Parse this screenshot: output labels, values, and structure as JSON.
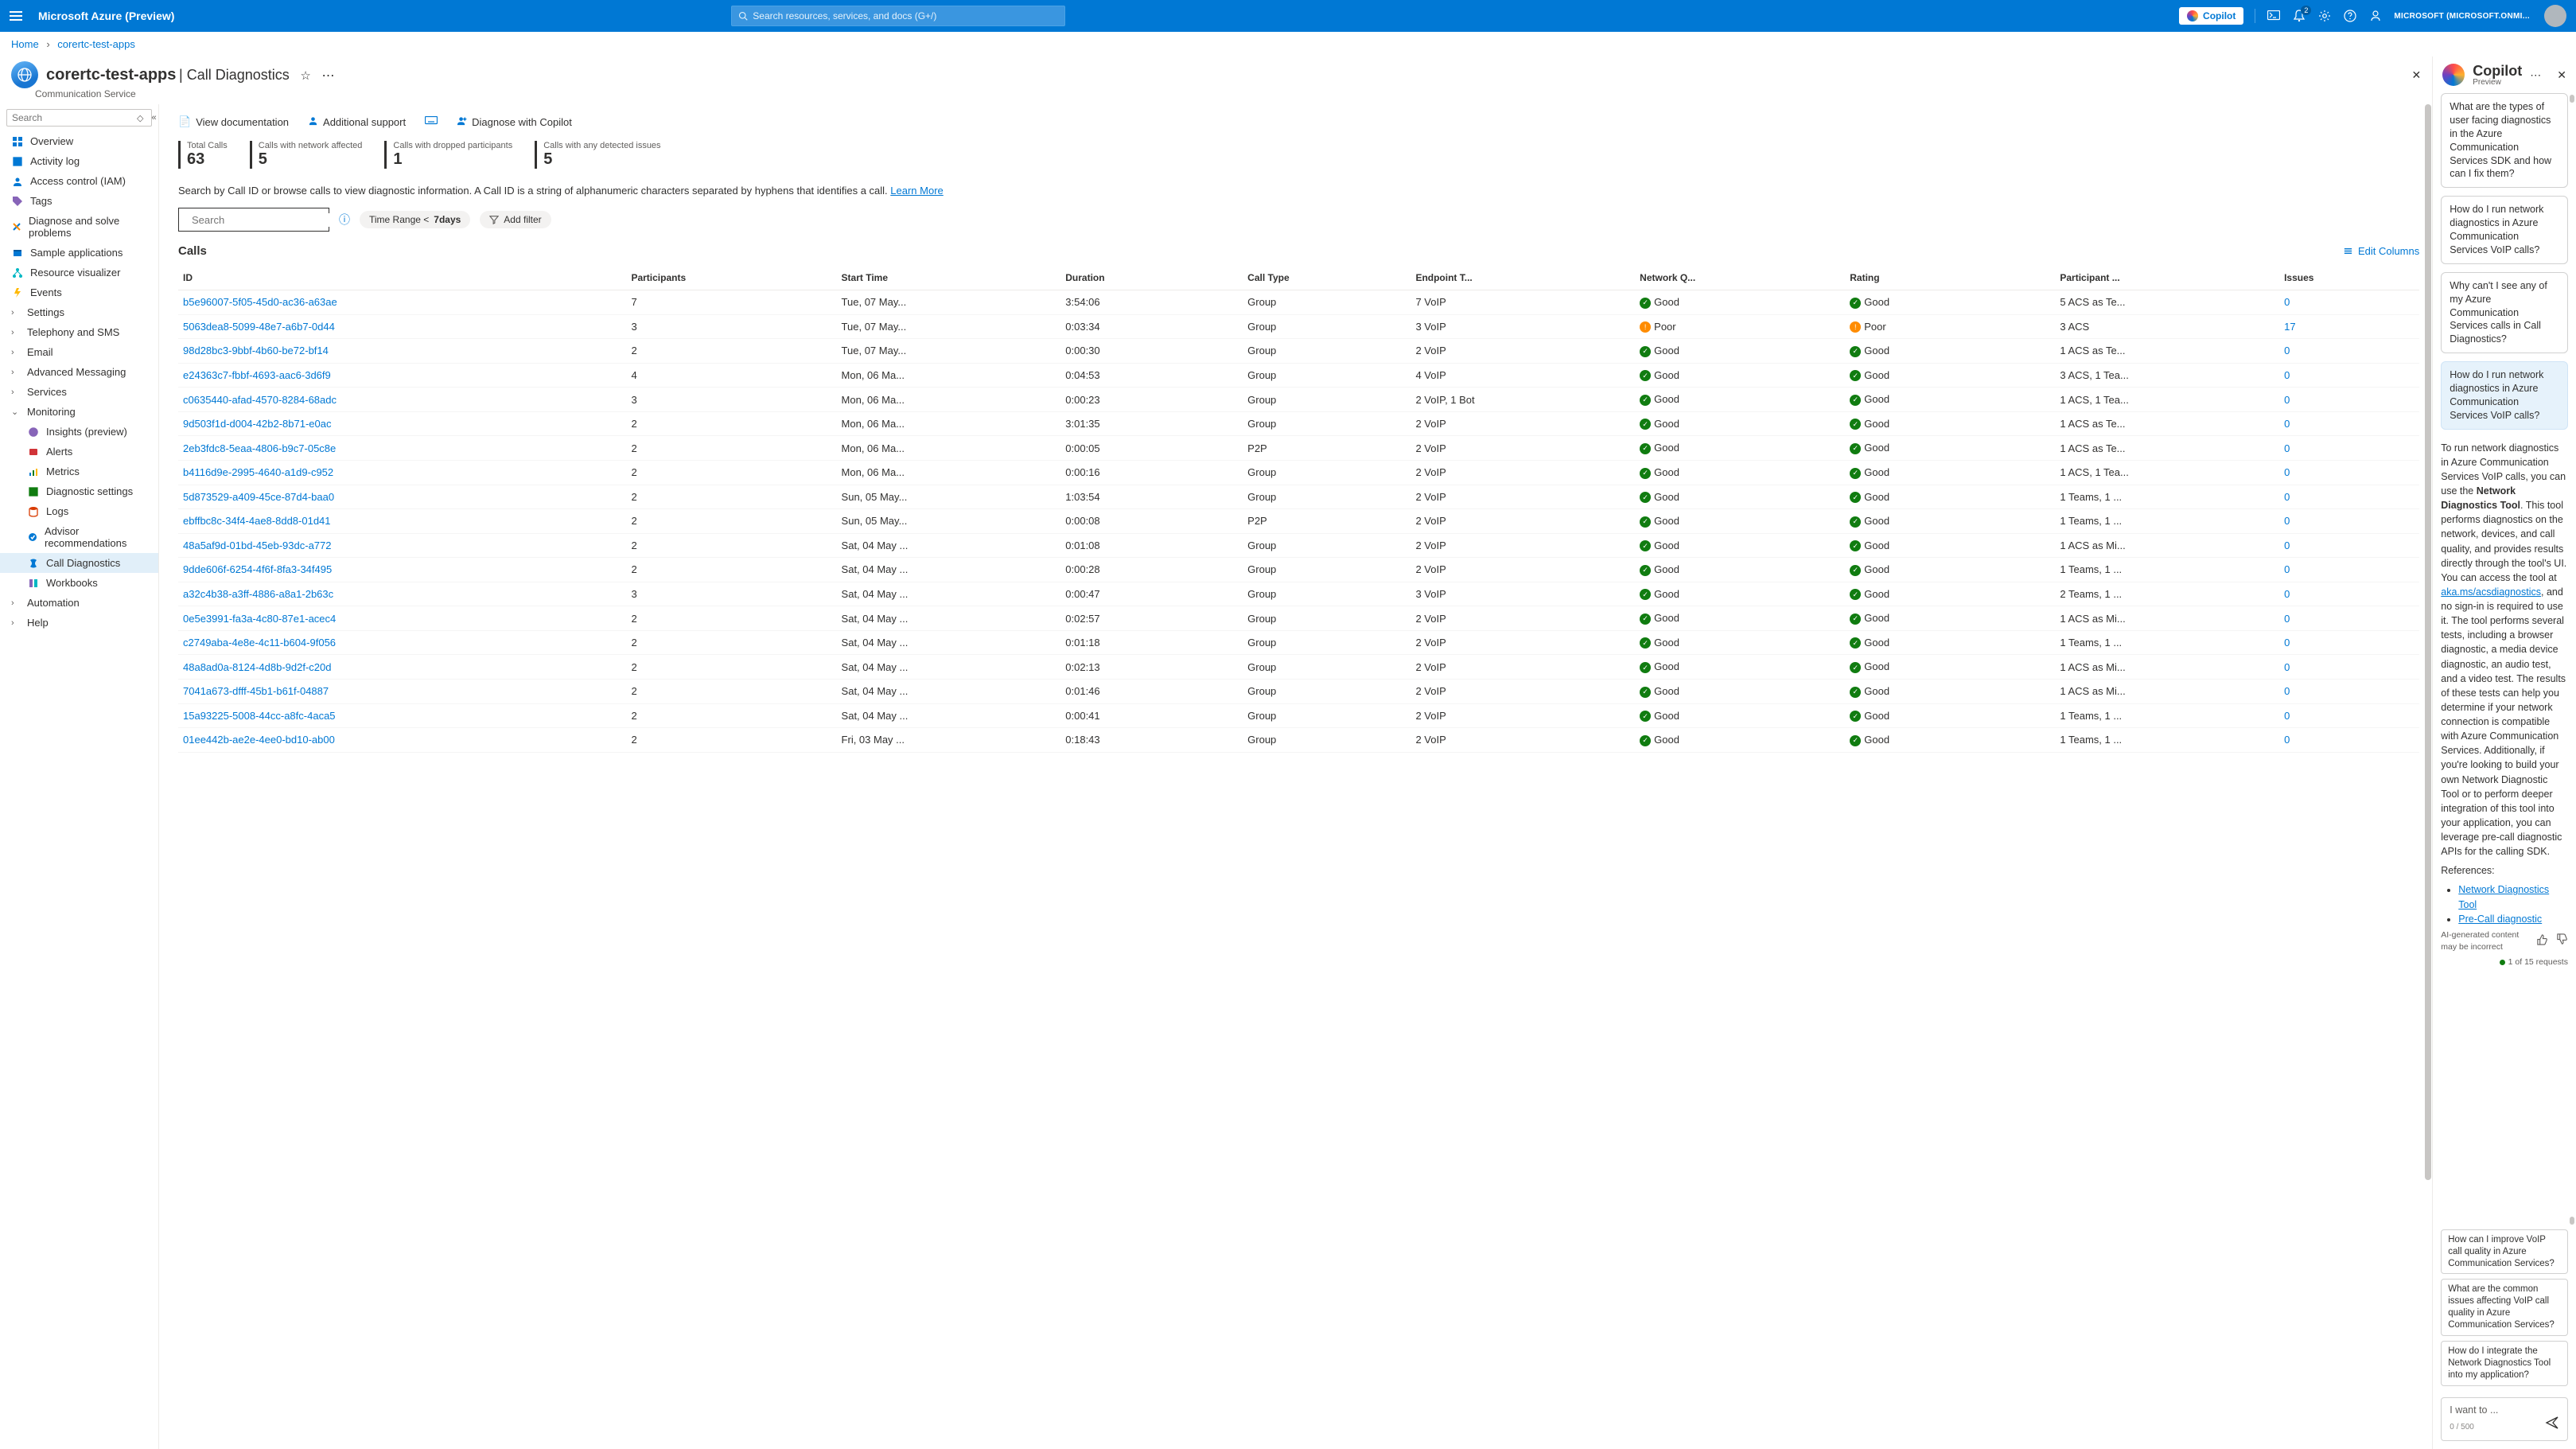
{
  "topbar": {
    "brand": "Microsoft Azure (Preview)",
    "search_placeholder": "Search resources, services, and docs (G+/)",
    "copilot_btn": "Copilot",
    "bell_badge": "2",
    "account": "MICROSOFT (MICROSOFT.ONMI...",
    "icons": {
      "cloudshell": "cloud-shell-icon",
      "bell": "notifications-icon",
      "gear": "settings-icon",
      "help": "help-icon",
      "feedback": "feedback-icon"
    }
  },
  "breadcrumb": {
    "home": "Home",
    "current": "corertc-test-apps"
  },
  "resource": {
    "name": "corertc-test-apps",
    "section": "Call Diagnostics",
    "subtitle": "Communication Service"
  },
  "sidebar": {
    "search_placeholder": "Search",
    "items": {
      "overview": "Overview",
      "activity": "Activity log",
      "iam": "Access control (IAM)",
      "tags": "Tags",
      "diagnose": "Diagnose and solve problems",
      "samples": "Sample applications",
      "resvis": "Resource visualizer",
      "events": "Events",
      "settings": "Settings",
      "telephony": "Telephony and SMS",
      "email": "Email",
      "advmsg": "Advanced Messaging",
      "services": "Services",
      "monitoring": "Monitoring",
      "insights": "Insights (preview)",
      "alerts": "Alerts",
      "metrics": "Metrics",
      "diagset": "Diagnostic settings",
      "logs": "Logs",
      "advisor": "Advisor recommendations",
      "calldiag": "Call Diagnostics",
      "workbooks": "Workbooks",
      "automation": "Automation",
      "help": "Help"
    }
  },
  "toolbar": {
    "view_doc": "View documentation",
    "add_support": "Additional support",
    "diag_copilot": "Diagnose with Copilot"
  },
  "stats": {
    "total_calls_label": "Total Calls",
    "total_calls_value": "63",
    "net_label": "Calls with network affected",
    "net_value": "5",
    "drop_label": "Calls with dropped participants",
    "drop_value": "1",
    "issues_label": "Calls with any detected issues",
    "issues_value": "5"
  },
  "helper": {
    "text": "Search by Call ID or browse calls to view diagnostic information. A Call ID is a string of alphanumeric characters separated by hyphens that identifies a call.",
    "learn_more": "Learn More"
  },
  "filters": {
    "search_placeholder": "Search",
    "time_label": "Time Range <",
    "time_value": "7days",
    "add_filter": "Add filter"
  },
  "calls_section": {
    "title": "Calls",
    "edit_columns": "Edit Columns"
  },
  "columns": {
    "id": "ID",
    "participants": "Participants",
    "start": "Start Time",
    "duration": "Duration",
    "calltype": "Call Type",
    "endpoint": "Endpoint T...",
    "netq": "Network Q...",
    "rating": "Rating",
    "partp": "Participant ...",
    "issues": "Issues"
  },
  "status_labels": {
    "good": "Good",
    "poor": "Poor"
  },
  "rows": [
    {
      "id": "b5e96007-5f05-45d0-ac36-a63ae",
      "p": "7",
      "start": "Tue, 07 May...",
      "dur": "3:54:06",
      "ct": "Group",
      "ep": "7 VoIP",
      "nq": "good",
      "rt": "good",
      "pp": "5 ACS as Te...",
      "iss": "0"
    },
    {
      "id": "5063dea8-5099-48e7-a6b7-0d44",
      "p": "3",
      "start": "Tue, 07 May...",
      "dur": "0:03:34",
      "ct": "Group",
      "ep": "3 VoIP",
      "nq": "poor",
      "rt": "poor",
      "pp": "3 ACS",
      "iss": "17"
    },
    {
      "id": "98d28bc3-9bbf-4b60-be72-bf14",
      "p": "2",
      "start": "Tue, 07 May...",
      "dur": "0:00:30",
      "ct": "Group",
      "ep": "2 VoIP",
      "nq": "good",
      "rt": "good",
      "pp": "1 ACS as Te...",
      "iss": "0"
    },
    {
      "id": "e24363c7-fbbf-4693-aac6-3d6f9",
      "p": "4",
      "start": "Mon, 06 Ma...",
      "dur": "0:04:53",
      "ct": "Group",
      "ep": "4 VoIP",
      "nq": "good",
      "rt": "good",
      "pp": "3 ACS, 1 Tea...",
      "iss": "0"
    },
    {
      "id": "c0635440-afad-4570-8284-68adc",
      "p": "3",
      "start": "Mon, 06 Ma...",
      "dur": "0:00:23",
      "ct": "Group",
      "ep": "2 VoIP, 1 Bot",
      "nq": "good",
      "rt": "good",
      "pp": "1 ACS, 1 Tea...",
      "iss": "0"
    },
    {
      "id": "9d503f1d-d004-42b2-8b71-e0ac",
      "p": "2",
      "start": "Mon, 06 Ma...",
      "dur": "3:01:35",
      "ct": "Group",
      "ep": "2 VoIP",
      "nq": "good",
      "rt": "good",
      "pp": "1 ACS as Te...",
      "iss": "0"
    },
    {
      "id": "2eb3fdc8-5eaa-4806-b9c7-05c8e",
      "p": "2",
      "start": "Mon, 06 Ma...",
      "dur": "0:00:05",
      "ct": "P2P",
      "ep": "2 VoIP",
      "nq": "good",
      "rt": "good",
      "pp": "1 ACS as Te...",
      "iss": "0"
    },
    {
      "id": "b4116d9e-2995-4640-a1d9-c952",
      "p": "2",
      "start": "Mon, 06 Ma...",
      "dur": "0:00:16",
      "ct": "Group",
      "ep": "2 VoIP",
      "nq": "good",
      "rt": "good",
      "pp": "1 ACS, 1 Tea...",
      "iss": "0"
    },
    {
      "id": "5d873529-a409-45ce-87d4-baa0",
      "p": "2",
      "start": "Sun, 05 May...",
      "dur": "1:03:54",
      "ct": "Group",
      "ep": "2 VoIP",
      "nq": "good",
      "rt": "good",
      "pp": "1 Teams, 1 ...",
      "iss": "0"
    },
    {
      "id": "ebffbc8c-34f4-4ae8-8dd8-01d41",
      "p": "2",
      "start": "Sun, 05 May...",
      "dur": "0:00:08",
      "ct": "P2P",
      "ep": "2 VoIP",
      "nq": "good",
      "rt": "good",
      "pp": "1 Teams, 1 ...",
      "iss": "0"
    },
    {
      "id": "48a5af9d-01bd-45eb-93dc-a772",
      "p": "2",
      "start": "Sat, 04 May ...",
      "dur": "0:01:08",
      "ct": "Group",
      "ep": "2 VoIP",
      "nq": "good",
      "rt": "good",
      "pp": "1 ACS as Mi...",
      "iss": "0"
    },
    {
      "id": "9dde606f-6254-4f6f-8fa3-34f495",
      "p": "2",
      "start": "Sat, 04 May ...",
      "dur": "0:00:28",
      "ct": "Group",
      "ep": "2 VoIP",
      "nq": "good",
      "rt": "good",
      "pp": "1 Teams, 1 ...",
      "iss": "0"
    },
    {
      "id": "a32c4b38-a3ff-4886-a8a1-2b63c",
      "p": "3",
      "start": "Sat, 04 May ...",
      "dur": "0:00:47",
      "ct": "Group",
      "ep": "3 VoIP",
      "nq": "good",
      "rt": "good",
      "pp": "2 Teams, 1 ...",
      "iss": "0"
    },
    {
      "id": "0e5e3991-fa3a-4c80-87e1-acec4",
      "p": "2",
      "start": "Sat, 04 May ...",
      "dur": "0:02:57",
      "ct": "Group",
      "ep": "2 VoIP",
      "nq": "good",
      "rt": "good",
      "pp": "1 ACS as Mi...",
      "iss": "0"
    },
    {
      "id": "c2749aba-4e8e-4c11-b604-9f056",
      "p": "2",
      "start": "Sat, 04 May ...",
      "dur": "0:01:18",
      "ct": "Group",
      "ep": "2 VoIP",
      "nq": "good",
      "rt": "good",
      "pp": "1 Teams, 1 ...",
      "iss": "0"
    },
    {
      "id": "48a8ad0a-8124-4d8b-9d2f-c20d",
      "p": "2",
      "start": "Sat, 04 May ...",
      "dur": "0:02:13",
      "ct": "Group",
      "ep": "2 VoIP",
      "nq": "good",
      "rt": "good",
      "pp": "1 ACS as Mi...",
      "iss": "0"
    },
    {
      "id": "7041a673-dfff-45b1-b61f-04887",
      "p": "2",
      "start": "Sat, 04 May ...",
      "dur": "0:01:46",
      "ct": "Group",
      "ep": "2 VoIP",
      "nq": "good",
      "rt": "good",
      "pp": "1 ACS as Mi...",
      "iss": "0"
    },
    {
      "id": "15a93225-5008-44cc-a8fc-4aca5",
      "p": "2",
      "start": "Sat, 04 May ...",
      "dur": "0:00:41",
      "ct": "Group",
      "ep": "2 VoIP",
      "nq": "good",
      "rt": "good",
      "pp": "1 Teams, 1 ...",
      "iss": "0"
    },
    {
      "id": "01ee442b-ae2e-4ee0-bd10-ab00",
      "p": "2",
      "start": "Fri, 03 May ...",
      "dur": "0:18:43",
      "ct": "Group",
      "ep": "2 VoIP",
      "nq": "good",
      "rt": "good",
      "pp": "1 Teams, 1 ...",
      "iss": "0"
    }
  ],
  "copilot": {
    "title": "Copilot",
    "subtitle": "Preview",
    "suggestions": [
      "What are the types of user facing diagnostics in the Azure Communication Services SDK and how can I fix them?",
      "How do I run network diagnostics in Azure Communication Services VoIP calls?",
      "Why can't I see any of my Azure Communication Services calls in Call Diagnostics?"
    ],
    "user_q": "How do I run network diagnostics in Azure Communication Services VoIP calls?",
    "answer_p1": "To run network diagnostics in Azure Communication Services VoIP calls, you can use the ",
    "answer_bold": "Network Diagnostics Tool",
    "answer_p2": ". This tool performs diagnostics on the network, devices, and call quality, and provides results directly through the tool's UI. You can access the tool at ",
    "answer_link": "aka.ms/acsdiagnostics",
    "answer_p3": ", and no sign-in is required to use it. The tool performs several tests, including a browser diagnostic, a media device diagnostic, an audio test, and a video test. The results of these tests can help you determine if your network connection is compatible with Azure Communication Services. Additionally, if you're looking to build your own Network Diagnostic Tool or to perform deeper integration of this tool into your application, you can leverage pre-call diagnostic APIs for the calling SDK.",
    "references_label": "References:",
    "references": [
      "Network Diagnostics Tool",
      "Pre-Call diagnostic"
    ],
    "disclaimer": "AI-generated content may be incorrect",
    "req_count": "1 of 15 requests",
    "followups": [
      "How can I improve VoIP call quality in Azure Communication Services?",
      "What are the common issues affecting VoIP call quality in Azure Communication Services?",
      "How do I integrate the Network Diagnostics Tool into my application?"
    ],
    "input_placeholder": "I want to ...",
    "input_counter": "0 / 500"
  }
}
